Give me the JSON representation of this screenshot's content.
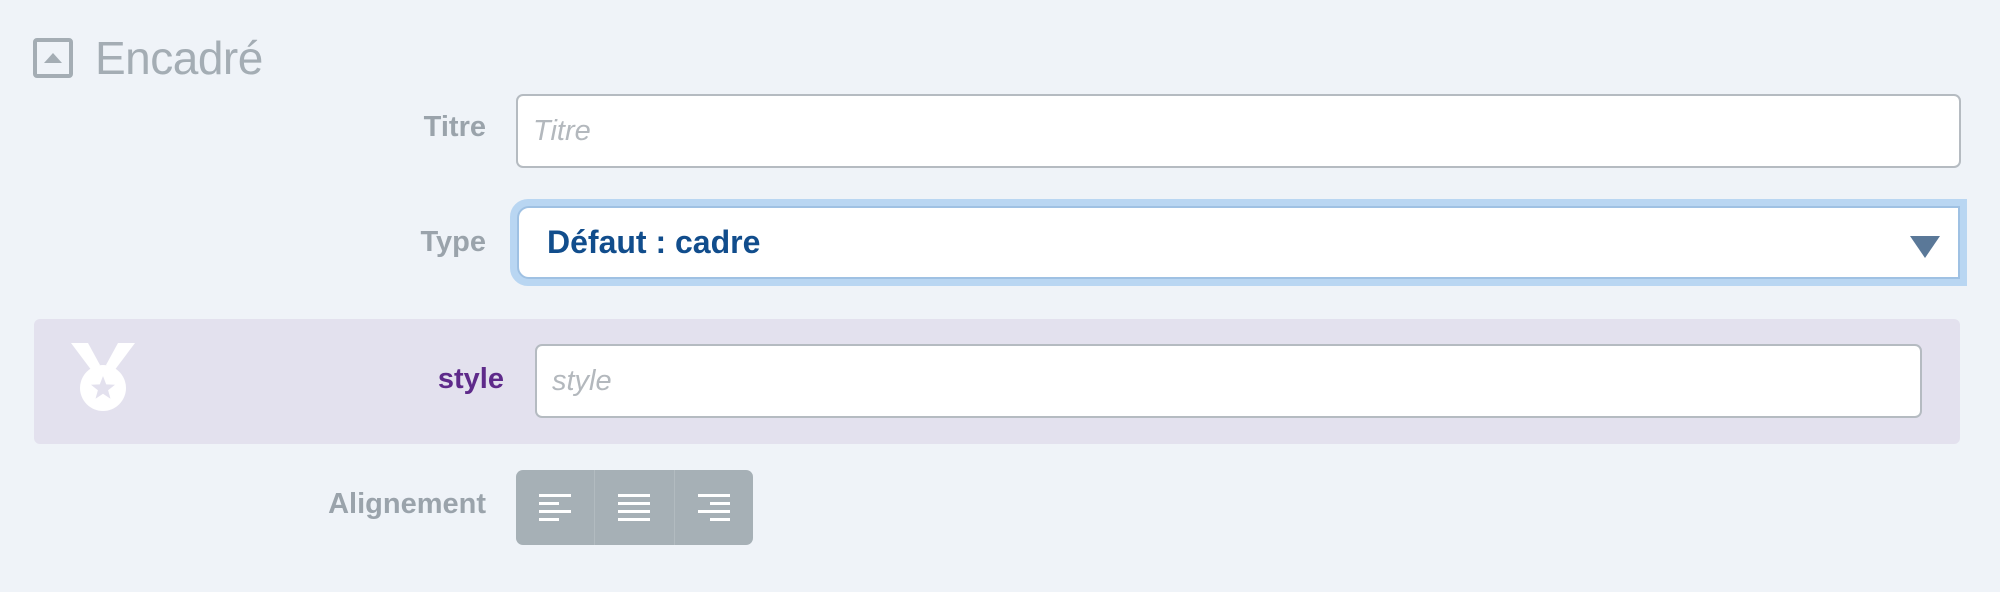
{
  "section": {
    "title": "Encadré",
    "toggle_icon": "collapse-up-icon"
  },
  "fields": {
    "titre": {
      "label": "Titre",
      "value": "",
      "placeholder": "Titre"
    },
    "type": {
      "label": "Type",
      "selected": "Défaut : cadre",
      "arrow_icon": "dropdown-arrow-icon"
    },
    "style": {
      "label": "style",
      "value": "",
      "placeholder": "style",
      "icon": "medal-icon",
      "panel_color": "#e3e1ee",
      "label_color": "#5e2a8a"
    },
    "alignement": {
      "label": "Alignement",
      "options": [
        {
          "icon": "align-left-icon"
        },
        {
          "icon": "align-justify-icon"
        },
        {
          "icon": "align-right-icon"
        }
      ]
    }
  },
  "colors": {
    "background": "#eff3f8",
    "label": "#9aa3ab",
    "select_text": "#114d8c",
    "select_focus": "#b9d6f2",
    "button": "#a6b0b6"
  }
}
